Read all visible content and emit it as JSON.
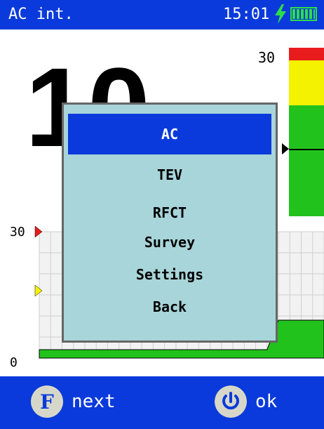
{
  "status_bar": {
    "title": "AC int.",
    "time": "15:01"
  },
  "main": {
    "big_value": "10",
    "gauge_top_label": "30"
  },
  "chart": {
    "y_top_label": "30",
    "y_bottom_label": "0"
  },
  "chart_data": {
    "type": "area",
    "x": [
      0,
      1,
      2,
      3,
      4,
      5,
      6,
      7,
      8,
      9,
      10,
      11,
      12,
      13,
      14,
      15,
      16,
      17,
      18,
      19,
      20,
      21,
      22,
      23,
      24,
      25
    ],
    "series": [
      {
        "values": [
          2,
          2,
          2,
          2,
          2,
          2,
          2,
          2,
          2,
          2,
          2,
          2,
          2,
          2,
          2,
          2,
          2,
          2,
          2,
          2,
          2,
          9,
          9,
          9,
          9,
          9
        ]
      }
    ],
    "ylim": [
      0,
      30
    ],
    "grid": true,
    "markers": {
      "red": 30,
      "yellow": 16
    }
  },
  "menu": {
    "items": [
      {
        "label": "AC",
        "selected": true
      },
      {
        "label": "TEV",
        "selected": false
      },
      {
        "label": "RFCT",
        "selected": false
      },
      {
        "label": "Survey",
        "selected": false
      },
      {
        "label": "Settings",
        "selected": false
      },
      {
        "label": "Back",
        "selected": false
      }
    ]
  },
  "bottom_bar": {
    "f_key": "F",
    "next_label": "next",
    "ok_label": "ok"
  },
  "colors": {
    "bar_blue": "#0a3adb",
    "menu_bg": "#a8d5da",
    "green": "#22c21c",
    "yellow": "#f5f200",
    "red": "#e81c1c"
  },
  "icons": {
    "charging": "lightning-bolt-icon",
    "battery": "battery-icon",
    "power": "power-icon"
  }
}
